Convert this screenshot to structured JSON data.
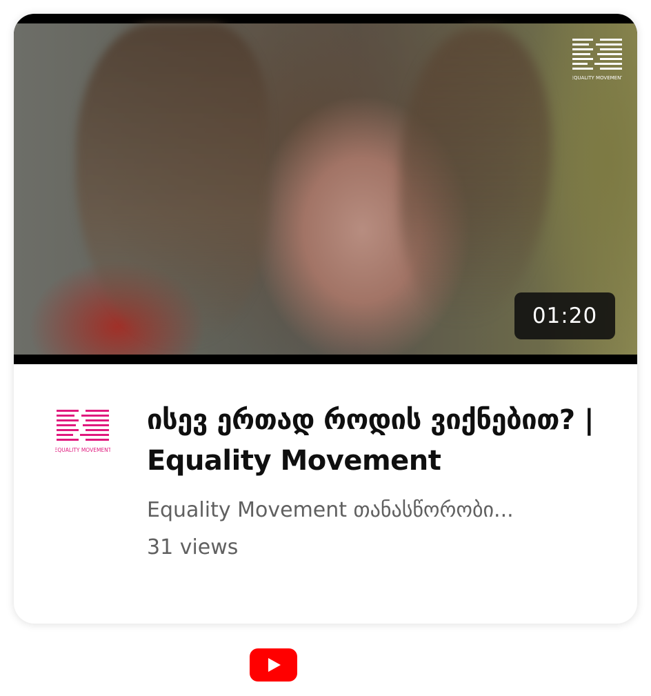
{
  "video": {
    "duration": "01:20",
    "title": "ისევ ერთად როდის ვიქნებით? | Equality Movement",
    "channel_line": "Equality Movement თანასწორობი...",
    "views": "31 views"
  },
  "brand": {
    "overlay_logo_text": "EQUALITY MOVEMENT",
    "channel_logo_text": "EQUALITY MOVEMENT",
    "channel_logo_color": "#e0197d",
    "overlay_logo_color": "#ffffff"
  },
  "footer": {
    "icon": "youtube-play-icon",
    "icon_color": "#ff0000"
  }
}
